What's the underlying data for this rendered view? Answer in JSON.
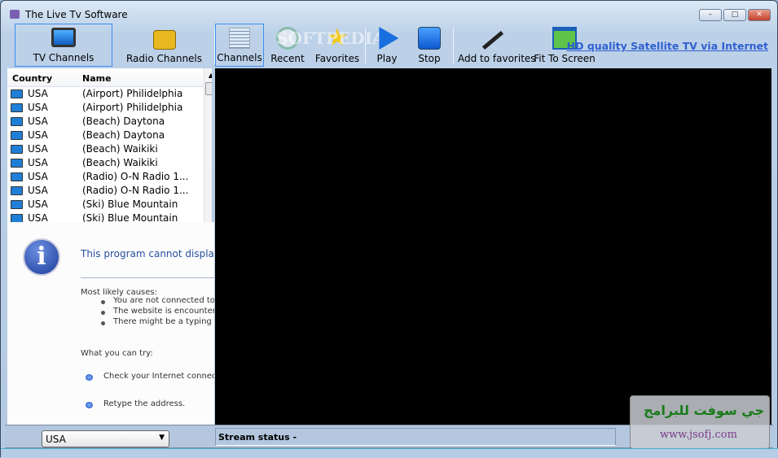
{
  "window": {
    "title": "The Live Tv Software",
    "minimize": "–",
    "maximize": "□",
    "close": "✕"
  },
  "toolbar": {
    "items": [
      {
        "label": "TV Channels",
        "icon": "tv-icon"
      },
      {
        "label": "Radio Channels",
        "icon": "radio-icon"
      },
      {
        "label": "Channels",
        "icon": "channel-list-icon"
      },
      {
        "label": "Recent",
        "icon": "clock-icon"
      },
      {
        "label": "Favorites",
        "icon": "star-icon"
      },
      {
        "label": "Play",
        "icon": "play-icon"
      },
      {
        "label": "Stop",
        "icon": "stop-icon"
      },
      {
        "label": "Add to favorites",
        "icon": "magic-wand-icon"
      },
      {
        "label": "Fit To Screen",
        "icon": "fit-screen-icon"
      }
    ],
    "link": "HD quality Satellite TV via Internet",
    "watermark": "SOFTPEDIA"
  },
  "channel_list": {
    "columns": [
      "Country",
      "Name"
    ],
    "rows": [
      {
        "country": "USA",
        "name": "(Airport) Philidelphia"
      },
      {
        "country": "USA",
        "name": "(Airport) Philidelphia"
      },
      {
        "country": "USA",
        "name": "(Beach) Daytona"
      },
      {
        "country": "USA",
        "name": "(Beach) Daytona"
      },
      {
        "country": "USA",
        "name": "(Beach) Waikiki"
      },
      {
        "country": "USA",
        "name": "(Beach) Waikiki"
      },
      {
        "country": "USA",
        "name": "(Radio) O-N Radio 1..."
      },
      {
        "country": "USA",
        "name": "(Radio) O-N Radio 1..."
      },
      {
        "country": "USA",
        "name": "(Ski) Blue Mountain"
      },
      {
        "country": "USA",
        "name": "(Ski) Blue Mountain"
      }
    ]
  },
  "error_page": {
    "title": "This program cannot display th",
    "causes_heading": "Most likely causes:",
    "causes": [
      "You are not connected to t",
      "The website is encountering",
      "There might be a typing err"
    ],
    "try_heading": "What you can try:",
    "try": [
      "Check your Internet connectic",
      "Retype the address."
    ]
  },
  "status": {
    "country_select": "USA",
    "stream_status": "Stream status -"
  },
  "watermark": {
    "arabic": "جي سوفت للبرامج",
    "url": "www.jsofj.com"
  }
}
